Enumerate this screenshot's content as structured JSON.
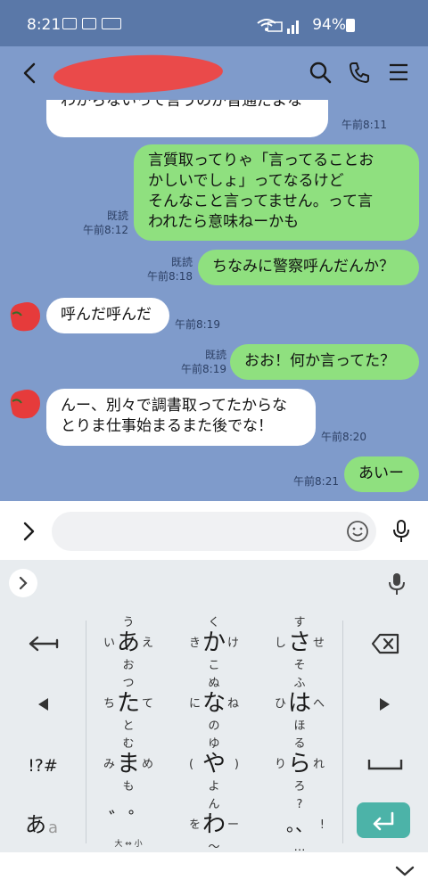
{
  "status_bar": {
    "time": "8:21",
    "battery": "94%",
    "wifi_label": "Wi-Fi"
  },
  "header": {
    "icons": [
      "back-icon",
      "search-icon",
      "phone-icon",
      "menu-icon"
    ]
  },
  "messages": [
    {
      "side": "in",
      "text": "わからないって言うのが普通だよな",
      "time": "午前8:11"
    },
    {
      "side": "out",
      "lines": [
        "言質取ってりゃ「言ってることお",
        "かしいでしょ」ってなるけど",
        "そんなこと言ってません。って言",
        "われたら意味ねーかも"
      ],
      "read": "既読",
      "time": "午前8:12"
    },
    {
      "side": "out",
      "text": "ちなみに警察呼んだんか？",
      "read": "既読",
      "time": "午前8:18"
    },
    {
      "side": "in",
      "text": "呼んだ呼んだ",
      "time": "午前8:19"
    },
    {
      "side": "out",
      "text": "おお！何か言ってた？",
      "read": "既読",
      "time": "午前8:19"
    },
    {
      "side": "in",
      "lines": [
        "んー、別々で調書取ってたからな",
        "とりま仕事始まるまた後でな！"
      ],
      "time": "午前8:20"
    },
    {
      "side": "out",
      "text": "あいー",
      "time": "午前8:21"
    }
  ],
  "input": {
    "placeholder": ""
  },
  "keyboard": {
    "keys": [
      {
        "main": "あ",
        "top": "う",
        "left": "い",
        "right": "え",
        "bottom": "お"
      },
      {
        "main": "か",
        "top": "く",
        "left": "き",
        "right": "け",
        "bottom": "こ"
      },
      {
        "main": "さ",
        "top": "す",
        "left": "し",
        "right": "せ",
        "bottom": "そ"
      },
      {
        "main": "た",
        "top": "つ",
        "left": "ち",
        "right": "て",
        "bottom": "と"
      },
      {
        "main": "な",
        "top": "ぬ",
        "left": "に",
        "right": "ね",
        "bottom": "の"
      },
      {
        "main": "は",
        "top": "ふ",
        "left": "ひ",
        "right": "へ",
        "bottom": "ほ"
      },
      {
        "main": "ま",
        "top": "む",
        "left": "み",
        "right": "め",
        "bottom": "も"
      },
      {
        "main": "や",
        "top": "ゆ",
        "left": "(",
        "right": ")",
        "bottom": "よ"
      },
      {
        "main": "ら",
        "top": "る",
        "left": "り",
        "right": "れ",
        "bottom": "ろ"
      },
      {
        "main": "わ",
        "top": "ん",
        "left": "を",
        "right": "ー",
        "bottom": "〜"
      }
    ],
    "symbol_key": "!?#",
    "mode_key": "あ",
    "mode_key_sub": "a",
    "dakuten_key": "゛゜",
    "dakuten_sub": "大 ⇔ 小",
    "punct_key": "。、",
    "punct_top": "?",
    "punct_right": "!",
    "punct_bottom": "…"
  }
}
